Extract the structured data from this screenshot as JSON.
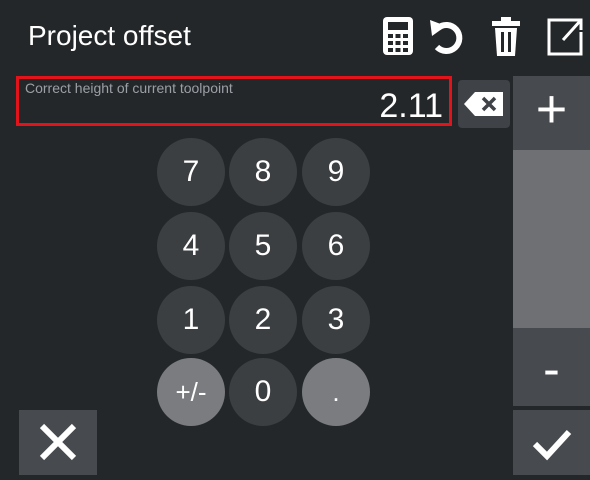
{
  "header": {
    "title": "Project offset",
    "tools": [
      {
        "icon": "calculator-icon"
      },
      {
        "icon": "undo-icon"
      },
      {
        "icon": "trash-icon"
      },
      {
        "icon": "expand-icon"
      }
    ]
  },
  "field": {
    "label": "Correct height of current toolpoint",
    "value": "2.11"
  },
  "keypad": {
    "k7": "7",
    "k8": "8",
    "k9": "9",
    "k4": "4",
    "k5": "5",
    "k6": "6",
    "k1": "1",
    "k2": "2",
    "k3": "3",
    "sign": "+/-",
    "k0": "0",
    "dot": "."
  },
  "side": {
    "plus": "+",
    "minus": "-"
  },
  "colors": {
    "background": "#24272a",
    "highlight_border": "#e3131b",
    "key": "#3c3f42",
    "key_light": "#7a7c7f",
    "button": "#474a4e",
    "track": "#6e7074"
  }
}
